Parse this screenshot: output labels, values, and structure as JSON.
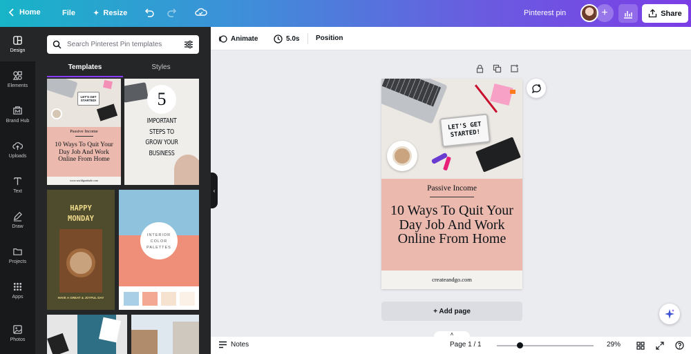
{
  "topbar": {
    "home_label": "Home",
    "file_label": "File",
    "resize_label": "Resize",
    "title": "Pinterest pin",
    "share_label": "Share"
  },
  "rail": {
    "items": [
      {
        "label": "Design",
        "icon": "layout-icon"
      },
      {
        "label": "Elements",
        "icon": "shapes-icon"
      },
      {
        "label": "Brand Hub",
        "icon": "brand-icon"
      },
      {
        "label": "Uploads",
        "icon": "cloud-upload-icon"
      },
      {
        "label": "Text",
        "icon": "text-icon"
      },
      {
        "label": "Draw",
        "icon": "pen-icon"
      },
      {
        "label": "Projects",
        "icon": "folder-icon"
      },
      {
        "label": "Apps",
        "icon": "grid-icon"
      },
      {
        "label": "Photos",
        "icon": "image-icon"
      }
    ]
  },
  "panel": {
    "search_placeholder": "Search Pinterest Pin templates",
    "tabs": [
      "Templates",
      "Styles"
    ],
    "templates": {
      "t1": {
        "subtitle": "Passive Income",
        "title": "10 Ways To Quit Your Day Job And Work Online From Home",
        "footer": "www.worldgratitude.com",
        "sign": "LET'S GET STARTED!"
      },
      "t2": {
        "number": "5",
        "title": "IMPORTANT STEPS TO GROW YOUR BUSINESS"
      },
      "t3": {
        "title": "HAPPY MONDAY",
        "footer": "HAVE A GREAT & JOYFUL DAY"
      },
      "t4": {
        "title": "INTERIOR COLOR PALETTES",
        "swatches": [
          "#a9cfe6",
          "#f3a894",
          "#f6e3cf",
          "#fbf1e6"
        ]
      }
    }
  },
  "toolbar": {
    "animate_label": "Animate",
    "duration_label": "5.0s",
    "position_label": "Position"
  },
  "pin": {
    "sign_text": "LET'S GET STARTED!",
    "subtitle": "Passive Income",
    "title": "10 Ways To Quit Your Day Job And Work Online From Home",
    "footer": "createandgo.com",
    "accent_color": "#ebb9ad"
  },
  "canvas": {
    "add_page_label": "+ Add page"
  },
  "bottombar": {
    "notes_label": "Notes",
    "page_label": "Page 1 / 1",
    "zoom_label": "29%",
    "zoom_fraction": 0.24
  }
}
